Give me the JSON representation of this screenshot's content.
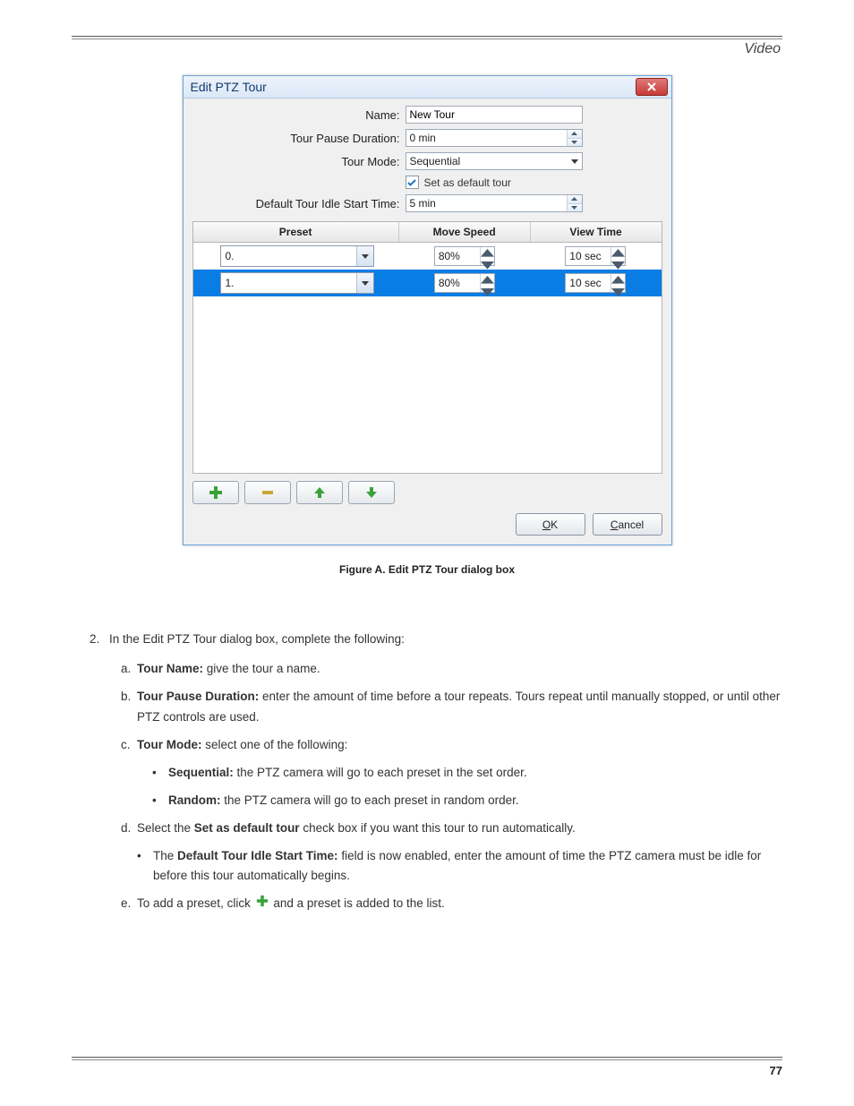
{
  "header": {
    "section": "Video"
  },
  "dialog": {
    "title": "Edit PTZ Tour",
    "labels": {
      "name": "Name:",
      "pause": "Tour Pause Duration:",
      "mode": "Tour Mode:",
      "default": "Set as default tour",
      "idle": "Default Tour Idle Start Time:"
    },
    "values": {
      "name": "New Tour",
      "pause": "0 min",
      "mode": "Sequential",
      "default_checked": true,
      "idle": "5 min"
    },
    "table": {
      "headers": {
        "preset": "Preset",
        "speed": "Move Speed",
        "time": "View Time"
      },
      "rows": [
        {
          "preset": "0.",
          "speed": "80%",
          "time": "10 sec",
          "selected": false
        },
        {
          "preset": "1.",
          "speed": "80%",
          "time": "10 sec",
          "selected": true
        }
      ]
    },
    "buttons": {
      "ok": "OK",
      "ok_u": "O",
      "ok_rest": "K",
      "cancel": "Cancel",
      "cancel_u": "C",
      "cancel_rest": "ancel"
    }
  },
  "caption": "Figure A.   Edit PTZ Tour dialog box",
  "body": {
    "step2_num": "2.",
    "step2_text": "In the Edit PTZ Tour dialog box, complete the following:",
    "sub_a": {
      "b": "a.",
      "label": "Tour Name:",
      "text": " give the tour a name."
    },
    "sub_b": {
      "b": "b.",
      "label": "Tour Pause Duration:",
      "text": " enter the amount of time before a tour repeats. Tours repeat until manually stopped, or until other PTZ controls are used."
    },
    "sub_c": {
      "b": "c.",
      "label": "Tour Mode:",
      "text": " select one of the following:"
    },
    "mode1": {
      "label": "Sequential:",
      "text": " the PTZ camera will go to each preset in the set order."
    },
    "mode2": {
      "label": "Random:",
      "text": " the PTZ camera will go to each preset in random order."
    },
    "sub_d": {
      "b": "d.",
      "label": "Set as default tour",
      "text1": "Select the ",
      "text2": " check box if you want this tour to run automatically."
    },
    "sub_d2": {
      "label": "Default Tour Idle Start Time:",
      "text1": "The ",
      "text2": " field is now enabled, enter the amount of time the PTZ camera must be idle for before this tour automatically begins."
    },
    "sub_e": {
      "b": "e.",
      "text1": "To add a preset, click ",
      "text2": " and a preset is added to the list."
    }
  },
  "page_number": "77"
}
